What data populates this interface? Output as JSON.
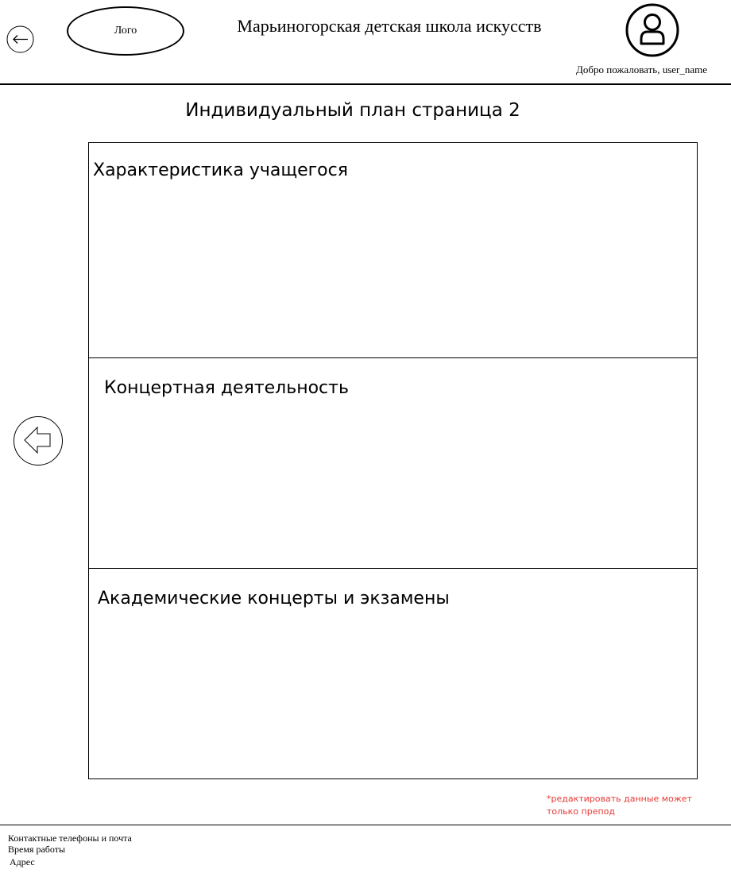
{
  "header": {
    "logo_label": "Лого",
    "school_name": "Марьиногорская детская школа искусств",
    "welcome_text": "Добро пожаловать, user_name"
  },
  "icons": {
    "back": "arrow-left-icon",
    "avatar": "user-icon",
    "prev_page": "arrow-left-outline-icon"
  },
  "page": {
    "title": "Индивидуальный план страница 2"
  },
  "sections": [
    {
      "title": "Характеристика учащегося"
    },
    {
      "title": "Концертная деятельность"
    },
    {
      "title": "Академические концерты и экзамены"
    }
  ],
  "note": {
    "text": "*редактировать данные может только препод",
    "color": "#e53935"
  },
  "footer": {
    "contacts": "Контактные телефоны и почта",
    "hours": "Время работы",
    "address": "Адрес"
  }
}
